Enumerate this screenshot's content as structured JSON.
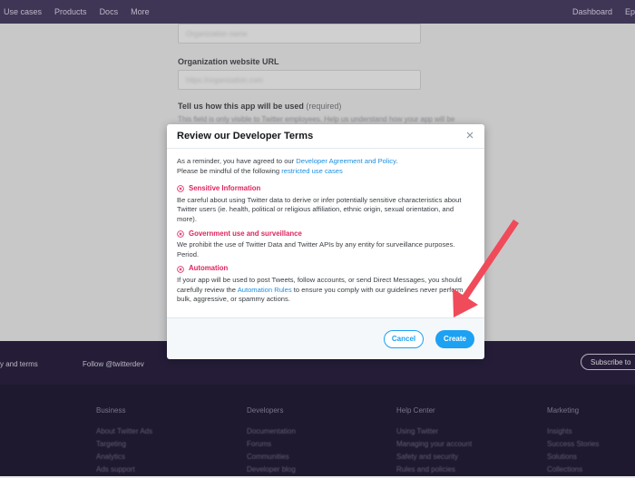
{
  "topnav": {
    "left_items": [
      "Use cases",
      "Products",
      "Docs",
      "More"
    ],
    "right_items": [
      "Dashboard",
      "Ep"
    ]
  },
  "form": {
    "field1_value": "Organization name",
    "website_label": "Organization website URL",
    "website_value": "https://organization.com",
    "usage_label": "Tell us how this app will be used",
    "usage_required": "(required)",
    "usage_help": "This field is only visible to Twitter employees. Help us understand how your app will be"
  },
  "footer": {
    "terms": "y and terms",
    "follow": "Follow @twitterdev",
    "subscribe": "Subscribe to",
    "columns": [
      {
        "head": "Business",
        "items": [
          "About Twitter Ads",
          "Targeting",
          "Analytics",
          "Ads support"
        ]
      },
      {
        "head": "Developers",
        "items": [
          "Documentation",
          "Forums",
          "Communities",
          "Developer blog"
        ]
      },
      {
        "head": "Help Center",
        "items": [
          "Using Twitter",
          "Managing your account",
          "Safety and security",
          "Rules and policies"
        ]
      },
      {
        "head": "Marketing",
        "items": [
          "Insights",
          "Success Stories",
          "Solutions",
          "Collections"
        ]
      }
    ]
  },
  "modal": {
    "title": "Review our Developer Terms",
    "intro_prefix": "As a reminder, you have agreed to our ",
    "intro_link": "Developer Agreement and Policy",
    "intro_suffix": ".",
    "intro2_prefix": "Please be mindful of the following ",
    "intro2_link": "restricted use cases",
    "sections": [
      {
        "title": "Sensitive Information",
        "body": "Be careful about using Twitter data to derive or infer potentially sensitive characteristics about Twitter users (ie. health, political or religious affiliation, ethnic origin, sexual orientation, and more)."
      },
      {
        "title": "Government use and surveillance",
        "body": "We prohibit the use of Twitter Data and Twitter APIs by any entity for surveillance purposes. Period."
      },
      {
        "title": "Automation",
        "body_prefix": "If your app will be used to post Tweets, follow accounts, or send Direct Messages, you should carefully review the ",
        "body_link": "Automation Rules",
        "body_suffix": " to ensure you comply with our guidelines never perform bulk, aggressive, or spammy actions."
      }
    ],
    "cancel_label": "Cancel",
    "create_label": "Create"
  },
  "colors": {
    "accent": "#1da1f2",
    "warning": "#e0245e",
    "annotation_arrow": "#f04b5a"
  }
}
